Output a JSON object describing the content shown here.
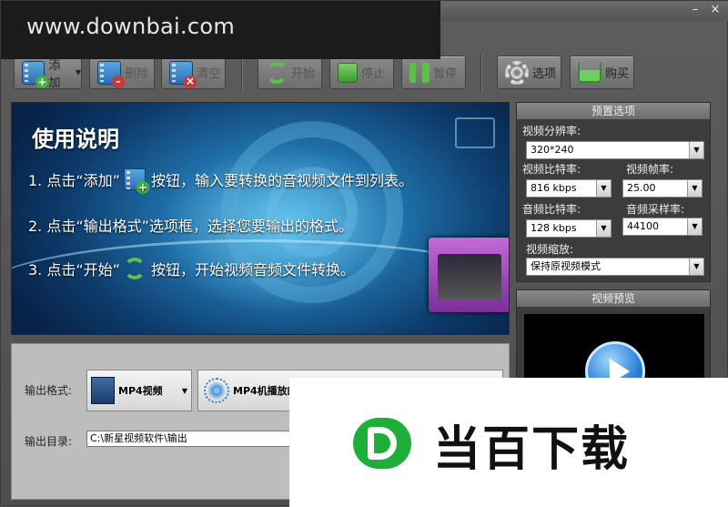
{
  "watermark": "www.downbai.com",
  "window": {
    "minimize": "–",
    "close": "×"
  },
  "toolbar": {
    "add": "添加",
    "delete": "删除",
    "clear": "清空",
    "start": "开始",
    "stop": "停止",
    "pause": "暂停",
    "options": "选项",
    "buy": "购买"
  },
  "banner": {
    "title": "使用说明",
    "step1_a": "1. 点击“添加”",
    "step1_b": "按钮，输入要转换的音视频文件到列表。",
    "step2": "2. 点击“输出格式”选项框，选择您要输出的格式。",
    "step3_a": "3. 点击“开始”",
    "step3_b": "按钮，开始视频音频文件转换。"
  },
  "output": {
    "format_label": "输出格式:",
    "format_value": "MP4视频",
    "device_value": "MP4机播放的",
    "dir_label": "输出目录:",
    "dir_value": "C:\\新星视频软件\\输出"
  },
  "presets": {
    "header": "预置选项",
    "resolution_label": "视频分辨率:",
    "resolution_value": "320*240",
    "vbitrate_label": "视频比特率:",
    "vbitrate_value": "816 kbps",
    "framerate_label": "视频帧率:",
    "framerate_value": "25.00",
    "abitrate_label": "音频比特率:",
    "abitrate_value": "128 kbps",
    "samplerate_label": "音频采样率:",
    "samplerate_value": "44100",
    "scale_label": "视频缩放:",
    "scale_value": "保持原视频模式"
  },
  "preview": {
    "header": "视频预览"
  },
  "logo": {
    "text": "当百下载"
  }
}
